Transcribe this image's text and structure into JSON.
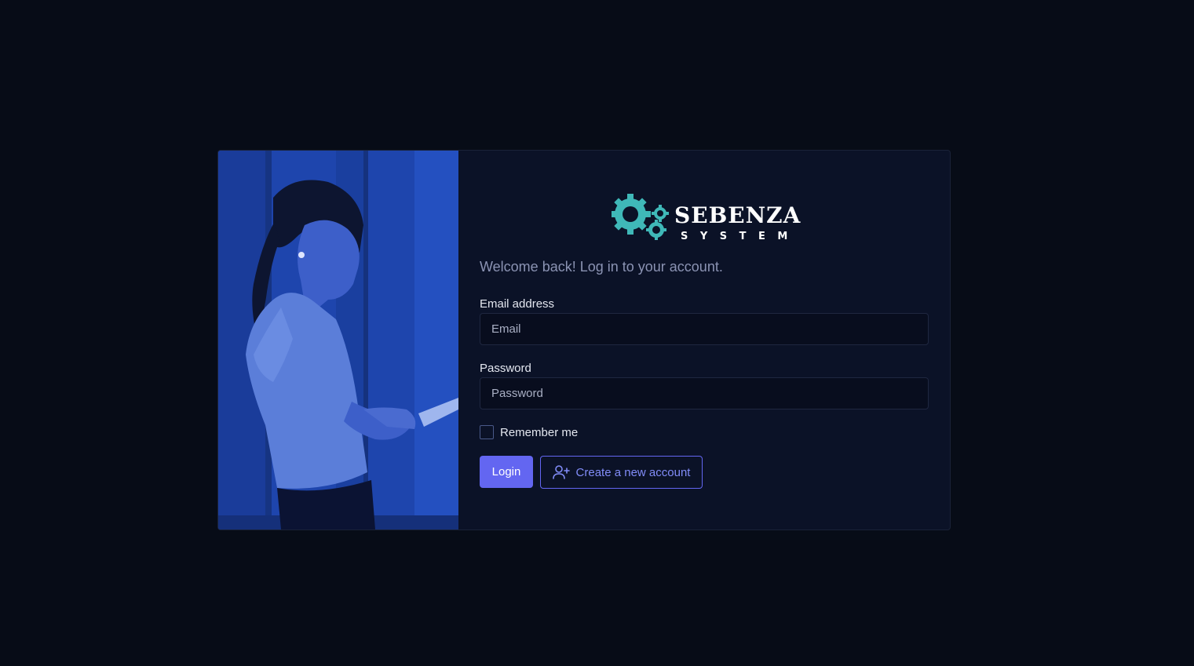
{
  "brand": {
    "name": "SEBENZA",
    "subtitle": "SYSTEM",
    "accent_color": "#3fb8b8"
  },
  "hero": {
    "image": "woman-using-tablet-photo"
  },
  "form": {
    "welcome": "Welcome back! Log in to your account.",
    "email": {
      "label": "Email address",
      "placeholder": "Email",
      "value": ""
    },
    "password": {
      "label": "Password",
      "placeholder": "Password",
      "value": ""
    },
    "remember_label": "Remember me",
    "remember_checked": false,
    "login_label": "Login",
    "create_label": "Create a new account",
    "create_icon": "user-plus-icon"
  },
  "colors": {
    "background": "#070c17",
    "card": "#0b1227",
    "primary": "#6366f1",
    "link": "#818cf8"
  }
}
